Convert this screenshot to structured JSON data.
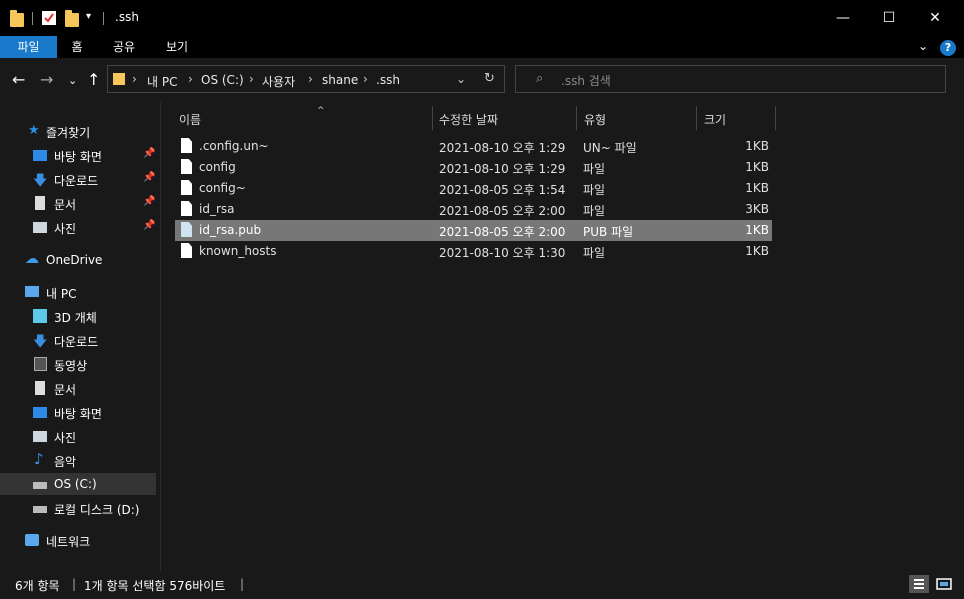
{
  "window": {
    "title": ".ssh"
  },
  "ribbon": {
    "tabs": [
      {
        "label": "파일"
      },
      {
        "label": "홈"
      },
      {
        "label": "공유"
      },
      {
        "label": "보기"
      }
    ],
    "help_label": "?"
  },
  "nav": {
    "breadcrumbs": [
      "내 PC",
      "OS (C:)",
      "사용자",
      "shane",
      ".ssh"
    ],
    "search_placeholder": ".ssh 검색"
  },
  "sidebar": {
    "quick_access": "즐겨찾기",
    "pinned": [
      {
        "label": "바탕 화면"
      },
      {
        "label": "다운로드"
      },
      {
        "label": "문서"
      },
      {
        "label": "사진"
      }
    ],
    "onedrive": "OneDrive",
    "this_pc": "내 PC",
    "pc_items": [
      {
        "label": "3D 개체"
      },
      {
        "label": "다운로드"
      },
      {
        "label": "동영상"
      },
      {
        "label": "문서"
      },
      {
        "label": "바탕 화면"
      },
      {
        "label": "사진"
      },
      {
        "label": "음악"
      },
      {
        "label": "OS (C:)"
      },
      {
        "label": "로컬 디스크 (D:)"
      }
    ],
    "network": "네트워크"
  },
  "columns": {
    "name": "이름",
    "modified": "수정한 날짜",
    "type": "유형",
    "size": "크기"
  },
  "files": [
    {
      "name": ".config.un~",
      "modified": "2021-08-10 오후 1:29",
      "type": "UN~ 파일",
      "size": "1KB"
    },
    {
      "name": "config",
      "modified": "2021-08-10 오후 1:29",
      "type": "파일",
      "size": "1KB"
    },
    {
      "name": "config~",
      "modified": "2021-08-05 오후 1:54",
      "type": "파일",
      "size": "1KB"
    },
    {
      "name": "id_rsa",
      "modified": "2021-08-05 오후 2:00",
      "type": "파일",
      "size": "3KB"
    },
    {
      "name": "id_rsa.pub",
      "modified": "2021-08-05 오후 2:00",
      "type": "PUB 파일",
      "size": "1KB"
    },
    {
      "name": "known_hosts",
      "modified": "2021-08-10 오후 1:30",
      "type": "파일",
      "size": "1KB"
    }
  ],
  "status": {
    "count": "6개 항목",
    "selection": "1개 항목 선택함 576바이트"
  },
  "colors": {
    "accent": "#1979ca",
    "background": "#191919",
    "selected_row": "#777777"
  }
}
